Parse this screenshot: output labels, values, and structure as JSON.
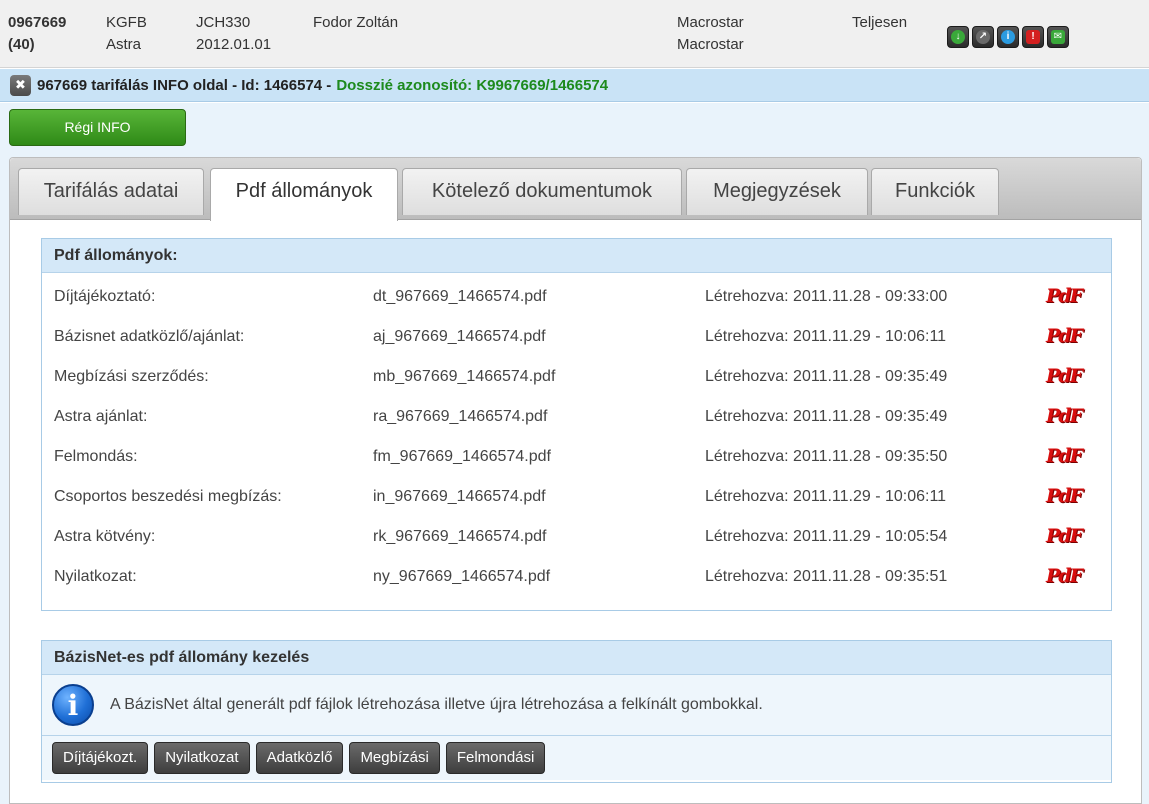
{
  "header": {
    "contract_id": "0967669",
    "count": "(40)",
    "product_type": "KGFB",
    "insurer": "Astra",
    "plate": "JCH330",
    "date": "2012.01.01",
    "client_name": "Fodor Zoltán",
    "partner_1": "Macrostar",
    "partner_2": "Macrostar",
    "status": "Teljesen",
    "icons": [
      {
        "name": "download-icon",
        "glyph": "↓",
        "color": "#3aa83a"
      },
      {
        "name": "arrow-icon",
        "glyph": "↗",
        "color": "#6a6a6a"
      },
      {
        "name": "info-icon",
        "glyph": "i",
        "color": "#2b9be0"
      },
      {
        "name": "alert-icon",
        "glyph": "!",
        "color": "#d42020"
      },
      {
        "name": "mail-icon",
        "glyph": "✉",
        "color": "#3aa83a"
      }
    ]
  },
  "titlebar": {
    "title": "967669 tarifálás INFO oldal - Id: 1466574 -",
    "dossier": "Dosszié azonosító: K9967669/1466574"
  },
  "regi_info_label": "Régi INFO",
  "tabs": [
    {
      "label": "Tarifálás adatai"
    },
    {
      "label": "Pdf állományok"
    },
    {
      "label": "Kötelező dokumentumok"
    },
    {
      "label": "Megjegyzések"
    },
    {
      "label": "Funkciók"
    }
  ],
  "pdf_section": {
    "title": "Pdf állományok:",
    "rows": [
      {
        "label": "Díjtájékoztató:",
        "file": "dt_967669_1466574.pdf",
        "created": "Létrehozva: 2011.11.28 - 09:33:00"
      },
      {
        "label": "Bázisnet adatközlő/ajánlat:",
        "file": "aj_967669_1466574.pdf",
        "created": "Létrehozva: 2011.11.29 - 10:06:11"
      },
      {
        "label": "Megbízási szerződés:",
        "file": "mb_967669_1466574.pdf",
        "created": "Létrehozva: 2011.11.28 - 09:35:49"
      },
      {
        "label": "Astra ajánlat:",
        "file": "ra_967669_1466574.pdf",
        "created": "Létrehozva: 2011.11.28 - 09:35:49"
      },
      {
        "label": "Felmondás:",
        "file": "fm_967669_1466574.pdf",
        "created": "Létrehozva: 2011.11.28 - 09:35:50"
      },
      {
        "label": "Csoportos beszedési megbízás:",
        "file": "in_967669_1466574.pdf",
        "created": "Létrehozva: 2011.11.29 - 10:06:11"
      },
      {
        "label": "Astra kötvény:",
        "file": "rk_967669_1466574.pdf",
        "created": "Létrehozva: 2011.11.29 - 10:05:54"
      },
      {
        "label": "Nyilatkozat:",
        "file": "ny_967669_1466574.pdf",
        "created": "Létrehozva: 2011.11.28 - 09:35:51"
      }
    ],
    "pdf_icon_text": "PdF"
  },
  "bazisnet_section": {
    "title": "BázisNet-es pdf állomány kezelés",
    "info_text": "A BázisNet által generált pdf fájlok létrehozása illetve újra létrehozása a felkínált gombokkal.",
    "buttons": [
      "Díjtájékozt.",
      "Nyilatkozat",
      "Adatközlő",
      "Megbízási",
      "Felmondási"
    ]
  }
}
